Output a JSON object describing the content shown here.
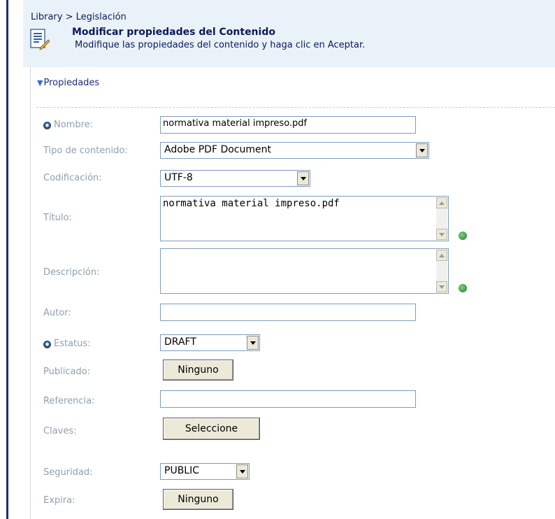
{
  "breadcrumb": "Library > Legislación",
  "header": {
    "title": "Modificar propiedades del Contenido",
    "subtitle": "Modifique las propiedades del contenido y haga clic en Aceptar.",
    "icon": "document-edit-icon"
  },
  "section": {
    "label": "Propiedades",
    "icon": "triangle-down-icon"
  },
  "fields": {
    "nombre": {
      "label": "Nombre:",
      "value": "normativa material impreso.pdf",
      "required": true
    },
    "tipo": {
      "label": "Tipo de contenido:",
      "value": "Adobe PDF Document"
    },
    "codificacion": {
      "label": "Codificación:",
      "value": "UTF-8"
    },
    "titulo": {
      "label": "Título:",
      "value": "normativa material impreso.pdf"
    },
    "descripcion": {
      "label": "Descripción:",
      "value": ""
    },
    "autor": {
      "label": "Autor:",
      "value": ""
    },
    "estatus": {
      "label": "Estatus:",
      "value": "DRAFT",
      "required": true
    },
    "publicado": {
      "label": "Publicado:",
      "button": "Ninguno"
    },
    "referencia": {
      "label": "Referencia:",
      "value": ""
    },
    "claves": {
      "label": "Claves:",
      "button": "Seleccione"
    },
    "seguridad": {
      "label": "Seguridad:",
      "value": "PUBLIC"
    },
    "expira": {
      "label": "Expira:",
      "button": "Ninguno"
    }
  },
  "colors": {
    "label": "#8fa0ae",
    "header_bg": "#eaf2f9",
    "accent": "#1c2f7a"
  }
}
